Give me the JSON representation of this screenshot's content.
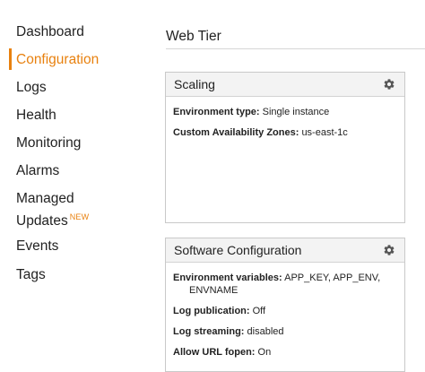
{
  "sidebar": {
    "items": [
      {
        "label": "Dashboard"
      },
      {
        "label": "Configuration",
        "active": true
      },
      {
        "label": "Logs"
      },
      {
        "label": "Health"
      },
      {
        "label": "Monitoring"
      },
      {
        "label": "Alarms"
      },
      {
        "label_line1": "Managed",
        "label_line2": "Updates",
        "badge": "NEW"
      },
      {
        "label": "Events"
      },
      {
        "label": "Tags"
      }
    ],
    "active_color": "#e8810f"
  },
  "main": {
    "title": "Web Tier",
    "panels": [
      {
        "title": "Scaling",
        "icon": "gear-icon",
        "rows": [
          {
            "label": "Environment type:",
            "value": "Single instance"
          },
          {
            "label": "Custom Availability Zones:",
            "value": "us-east-1c"
          }
        ]
      },
      {
        "title": "Software Configuration",
        "icon": "gear-icon",
        "rows": [
          {
            "label": "Environment variables:",
            "value": "APP_KEY, APP_ENV,",
            "value_cont": "ENVNAME"
          },
          {
            "label": "Log publication:",
            "value": "Off"
          },
          {
            "label": "Log streaming:",
            "value": "disabled"
          },
          {
            "label": "Allow URL fopen:",
            "value": "On"
          }
        ]
      }
    ]
  }
}
